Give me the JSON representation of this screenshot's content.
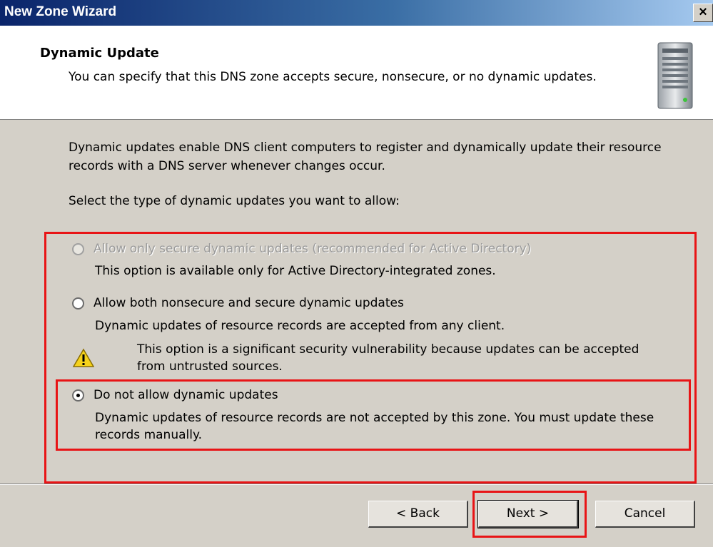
{
  "window": {
    "title": "New Zone Wizard",
    "close_label": "×"
  },
  "header": {
    "title": "Dynamic Update",
    "description": "You can specify that this DNS zone accepts secure, nonsecure, or no dynamic updates.",
    "icon": "server-icon"
  },
  "body": {
    "intro": "Dynamic updates enable DNS client computers to register and dynamically update their resource records with a DNS server whenever changes occur.",
    "prompt": "Select the type of dynamic updates you want to allow:"
  },
  "options": [
    {
      "label": "Allow only secure dynamic updates (recommended for Active Directory)",
      "description": "This option is available only for Active Directory-integrated zones.",
      "enabled": false,
      "selected": false
    },
    {
      "label": "Allow both nonsecure and secure dynamic updates",
      "description": "Dynamic updates of resource records are accepted from any client.",
      "warning": "This option is a significant security vulnerability because updates can be accepted from untrusted sources.",
      "enabled": true,
      "selected": false
    },
    {
      "label": "Do not allow dynamic updates",
      "description": "Dynamic updates of resource records are not accepted by this zone. You must update these records manually.",
      "enabled": true,
      "selected": true
    }
  ],
  "buttons": {
    "back": "< Back",
    "next": "Next >",
    "cancel": "Cancel"
  },
  "colors": {
    "highlight": "#e81416",
    "dialog_bg": "#d4d0c8",
    "title_bar": "#0a246a"
  }
}
